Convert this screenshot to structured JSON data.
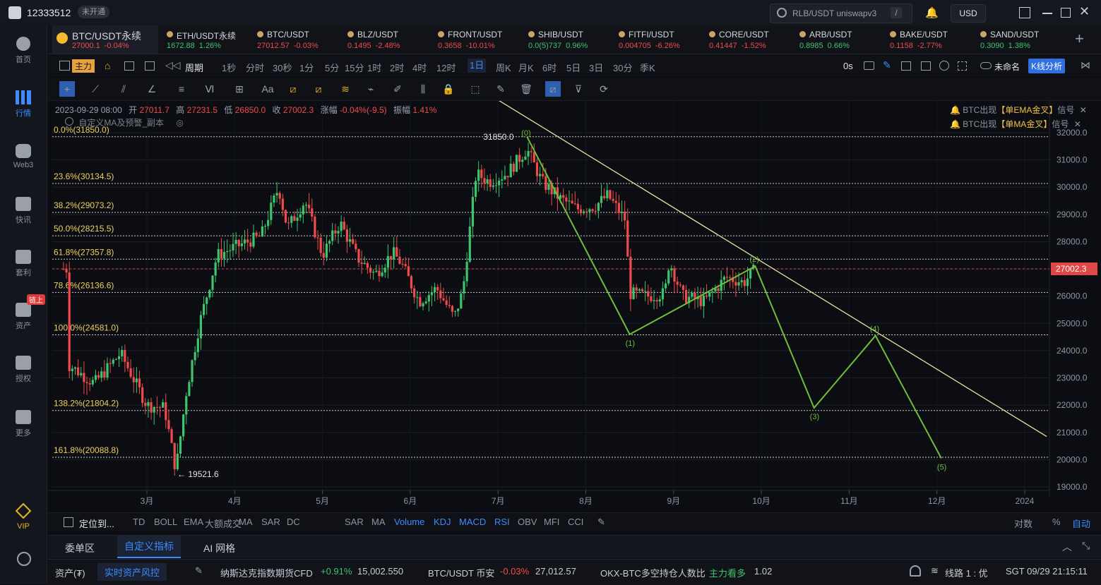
{
  "topbar": {
    "user_id": "12333512",
    "vip_status": "未开通",
    "search_placeholder": "RLB/USDT uniswapv3",
    "search_shortcut": "/",
    "currency": "USD"
  },
  "sidebar": {
    "items": [
      {
        "label": "首页",
        "icon": "home-icon"
      },
      {
        "label": "行情",
        "icon": "chart-bars-icon",
        "active": true
      },
      {
        "label": "Web3",
        "icon": "web3-icon"
      },
      {
        "label": "快讯",
        "icon": "news-icon"
      },
      {
        "label": "套利",
        "icon": "arbitrage-icon"
      },
      {
        "label": "资产",
        "icon": "wallet-icon",
        "badge": "链上"
      },
      {
        "label": "授权",
        "icon": "authorize-icon"
      },
      {
        "label": "更多",
        "icon": "more-icon"
      }
    ],
    "vip_label": "VIP"
  },
  "tickers": [
    {
      "name": "BTC/USDT永续",
      "price": "27000.1",
      "change": "-0.04%",
      "dir": "dn",
      "active": true
    },
    {
      "name": "ETH/USDT永续",
      "price": "1672.88",
      "change": "1.26%",
      "dir": "up"
    },
    {
      "name": "BTC/USDT",
      "price": "27012.57",
      "change": "-0.03%",
      "dir": "dn"
    },
    {
      "name": "BLZ/USDT",
      "price": "0.1495",
      "change": "-2.48%",
      "dir": "dn"
    },
    {
      "name": "FRONT/USDT",
      "price": "0.3658",
      "change": "-10.01%",
      "dir": "dn"
    },
    {
      "name": "SHIB/USDT",
      "price": "0.0(5)737",
      "change": "0.96%",
      "dir": "up"
    },
    {
      "name": "FITFI/USDT",
      "price": "0.004705",
      "change": "-6.26%",
      "dir": "dn"
    },
    {
      "name": "CORE/USDT",
      "price": "0.41447",
      "change": "-1.52%",
      "dir": "dn"
    },
    {
      "name": "ARB/USDT",
      "price": "0.8985",
      "change": "0.66%",
      "dir": "up"
    },
    {
      "name": "BAKE/USDT",
      "price": "0.1158",
      "change": "-2.77%",
      "dir": "dn"
    },
    {
      "name": "SAND/USDT",
      "price": "0.3090",
      "change": "1.38%",
      "dir": "up"
    }
  ],
  "toolbar": {
    "main_label": "主力",
    "period_label": "周期",
    "periods": [
      "1秒",
      "分时",
      "30秒",
      "1分",
      "5分",
      "15分",
      "1时",
      "2时",
      "4时",
      "12时",
      "1日",
      "周K",
      "月K",
      "6时",
      "5日",
      "3日",
      "30分",
      "季K"
    ],
    "active_period": "1日",
    "countdown": "0s",
    "layout_name": "未命名",
    "kline_analysis": "K线分析",
    "text_tool": "Aa"
  },
  "chart_info": {
    "date": "2023-09-29 08:00",
    "open_label": "开",
    "open": "27011.7",
    "high_label": "高",
    "high": "27231.5",
    "low_label": "低",
    "low": "26850.0",
    "close_label": "收",
    "close": "27002.3",
    "change_label": "涨幅",
    "change": "-0.04%(-9.5)",
    "amp_label": "振幅",
    "amp": "1.41%",
    "indicator_name": "自定义MA及预警_副本",
    "signal1_pre": "BTC出现",
    "signal1_hl": "【单EMA金叉】",
    "signal1_post": "信号",
    "signal2_pre": "BTC出现",
    "signal2_hl": "【单MA金叉】",
    "signal2_post": "信号"
  },
  "chart_data": {
    "type": "candlestick",
    "y_axis_ticks": [
      32000,
      31000,
      30000,
      29000,
      28000,
      27000,
      26000,
      25000,
      24000,
      23000,
      22000,
      21000,
      20000,
      19000
    ],
    "y_axis_labels": [
      "32000.0",
      "31000.0",
      "30000.0",
      "29000.0",
      "28000.0",
      "27002.3",
      "26000.0",
      "25000.0",
      "24000.0",
      "23000.0",
      "22000.0",
      "21000.0",
      "20000.0",
      "19000.0"
    ],
    "current_price": "27002.3",
    "x_axis_labels": [
      "3月",
      "4月",
      "5月",
      "6月",
      "7月",
      "8月",
      "9月",
      "10月",
      "11月",
      "12月",
      "2024"
    ],
    "fib_levels": [
      {
        "label": "0.0%(31850.0)",
        "price": 31850.0
      },
      {
        "label": "23.6%(30134.5)",
        "price": 30134.5
      },
      {
        "label": "38.2%(29073.2)",
        "price": 29073.2
      },
      {
        "label": "50.0%(28215.5)",
        "price": 28215.5
      },
      {
        "label": "61.8%(27357.8)",
        "price": 27357.8
      },
      {
        "label": "78.6%(26136.6)",
        "price": 26136.6
      },
      {
        "label": "100.0%(24581.0)",
        "price": 24581.0
      },
      {
        "label": "138.2%(21804.2)",
        "price": 21804.2
      },
      {
        "label": "161.8%(20088.8)",
        "price": 20088.8
      }
    ],
    "annotations": {
      "high": "31850.0",
      "low": "← 19521.6"
    },
    "wave_labels": [
      "(0)",
      "(1)",
      "(2)",
      "(3)",
      "(4)",
      "(5)"
    ],
    "wave_points": [
      {
        "month": 7.33,
        "price": 31850
      },
      {
        "month": 8.5,
        "price": 24600
      },
      {
        "month": 9.93,
        "price": 27100
      },
      {
        "month": 10.6,
        "price": 21900
      },
      {
        "month": 11.3,
        "price": 24550
      },
      {
        "month": 12.05,
        "price": 20050
      }
    ]
  },
  "indicators": {
    "locate": "定位到...",
    "main": [
      "TD",
      "BOLL",
      "EMA",
      "大额成交",
      "MA",
      "SAR",
      "DC"
    ],
    "sub": [
      "SAR",
      "MA",
      "Volume",
      "KDJ",
      "MACD",
      "RSI",
      "OBV",
      "MFI",
      "CCI"
    ],
    "active_sub": [
      "Volume",
      "KDJ",
      "MACD",
      "RSI"
    ],
    "right": [
      "对数",
      "%",
      "自动"
    ]
  },
  "bottom_tabs": [
    "委单区",
    "自定义指标",
    "AI 网格"
  ],
  "status": {
    "assets": "资产(₮)",
    "risk": "实时资产风控",
    "item1_name": "纳斯达克指数期货CFD",
    "item1_change": "+0.91%",
    "item1_value": "15,002.550",
    "item2_name": "BTC/USDT 币安",
    "item2_change": "-0.03%",
    "item2_value": "27,012.57",
    "item3_name": "OKX-BTC多空持仓人数比",
    "item3_tag": "主力看多",
    "item3_value": "1.02",
    "line": "线路 1 : 优",
    "time": "SGT  09/29 21:15:11"
  }
}
